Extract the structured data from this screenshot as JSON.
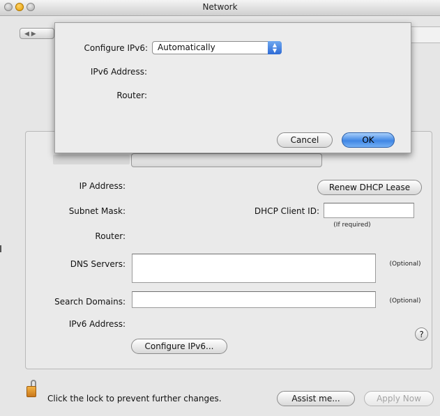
{
  "window": {
    "title": "Network",
    "nav_label": "◀ ▶"
  },
  "panel": {
    "ip_address_label": "IP Address:",
    "subnet_mask_label": "Subnet Mask:",
    "router_label": "Router:",
    "dns_servers_label": "DNS Servers:",
    "search_domains_label": "Search Domains:",
    "ipv6_address_label": "IPv6 Address:",
    "renew_dhcp_label": "Renew DHCP Lease",
    "dhcp_client_id_label": "DHCP Client ID:",
    "dhcp_client_id_value": "",
    "if_required_note": "(If required)",
    "dns_servers_value": "",
    "dns_optional_note": "(Optional)",
    "search_domains_value": "",
    "search_optional_note": "(Optional)",
    "configure_ipv6_button": "Configure IPv6...",
    "help_label": "?"
  },
  "footer": {
    "lock_text": "Click the lock to prevent further changes.",
    "assist_me_button": "Assist me...",
    "apply_now_button": "Apply Now"
  },
  "sheet": {
    "configure_ipv6_label": "Configure IPv6:",
    "configure_ipv6_selected": "Automatically",
    "ipv6_address_label": "IPv6 Address:",
    "router_label": "Router:",
    "cancel_button": "Cancel",
    "ok_button": "OK"
  },
  "colors": {
    "default_button": "#3f86e4",
    "popup_arrow": "#2e6bd6",
    "lock": "#f3b344"
  },
  "icons": {
    "lock": "lock-icon",
    "help": "help-icon",
    "popup_arrows": "chevron-updown-icon"
  }
}
